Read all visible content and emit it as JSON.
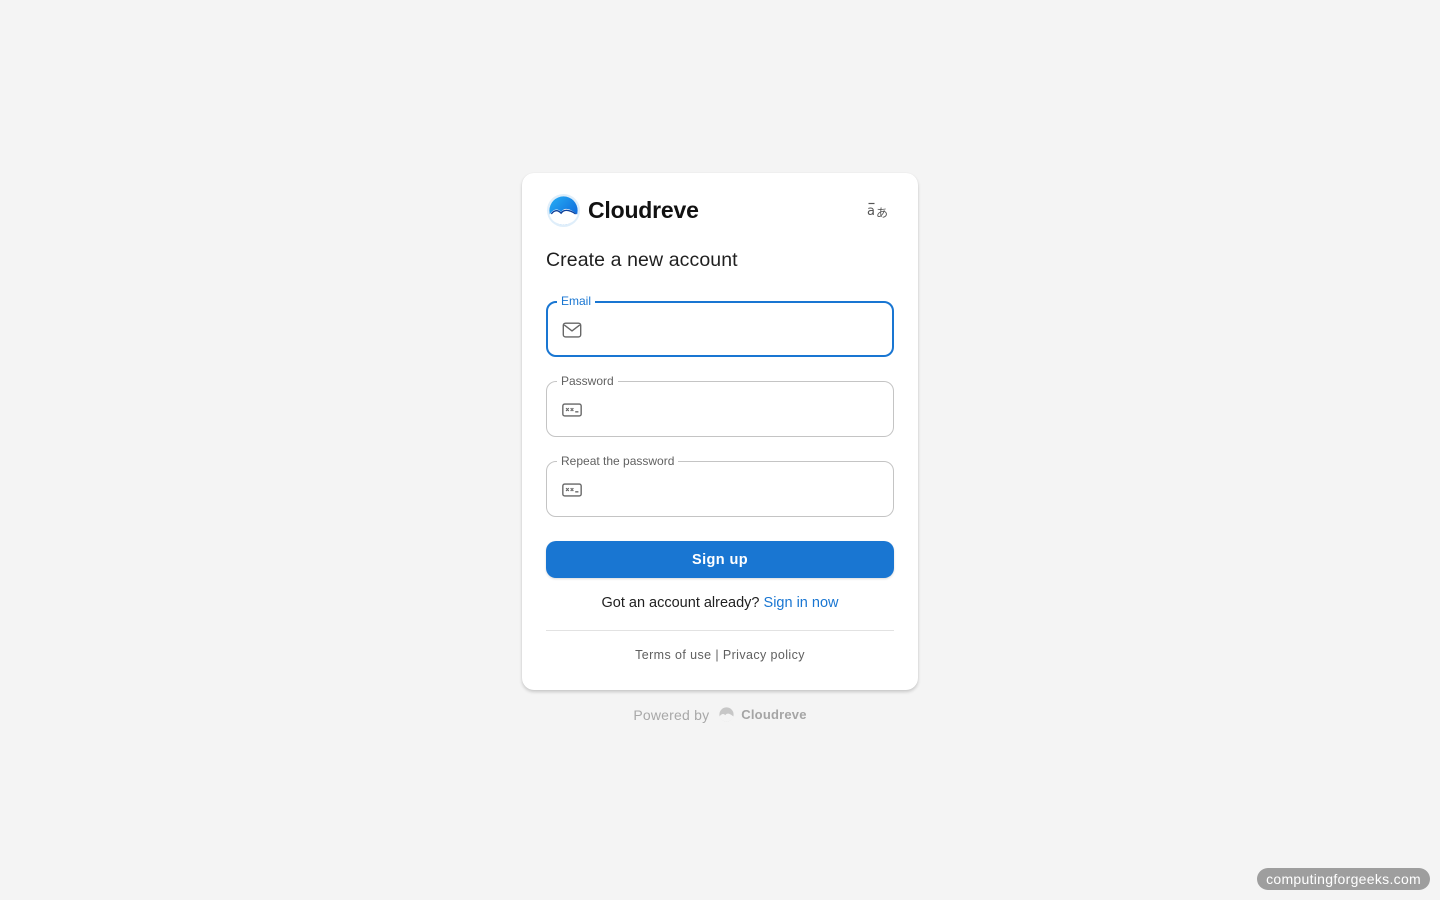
{
  "app": {
    "name": "Cloudreve",
    "language_icon": "translate-icon"
  },
  "form": {
    "title": "Create a new account",
    "email": {
      "label": "Email",
      "value": "",
      "icon": "mail-icon"
    },
    "password": {
      "label": "Password",
      "value": "",
      "icon": "password-icon"
    },
    "repeat_password": {
      "label": "Repeat the password",
      "value": "",
      "icon": "password-icon"
    },
    "submit_label": "Sign up",
    "signin_prompt": "Got an account already?",
    "signin_link": "Sign in now",
    "terms_label": "Terms of use",
    "separator": "|",
    "privacy_label": "Privacy policy"
  },
  "footer": {
    "powered_by": "Powered by",
    "powered_name": "Cloudreve"
  },
  "watermark": "computingforgeeks.com",
  "colors": {
    "accent": "#1976d2",
    "background": "#f4f4f4",
    "card": "#ffffff"
  }
}
